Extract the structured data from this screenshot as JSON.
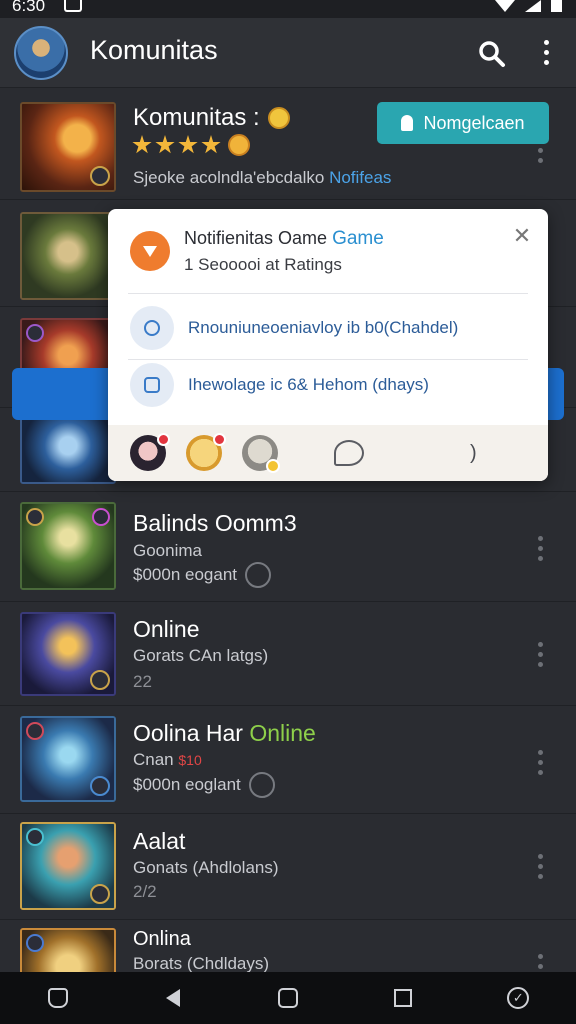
{
  "status_bar": {
    "time": "6:30"
  },
  "app_bar": {
    "title": "Komunitas"
  },
  "featured": {
    "title": "Komunitas :",
    "rating_stars": 4,
    "join_label": "Nomgelcaen",
    "description": "Sjeoke acolndla'ebcdalko",
    "description_link": "Nofifeas"
  },
  "popup": {
    "title_prefix": "Notifienitas Oame",
    "title_highlight": "Game",
    "subtitle": "1 Seooooi at Ratings",
    "items": [
      {
        "text": "Rnouniuneoeniavloy ib b0(Chahdel)"
      },
      {
        "text": "Ihewolage ic 6& Hehom (dhays)"
      }
    ],
    "footer_end": ")"
  },
  "rows": [
    {
      "title": "Balinds Oomm3",
      "sub": "Goonima",
      "meta": "$000n eogant",
      "has_ring": true
    },
    {
      "title": "Online",
      "sub": "Gorats CAn latgs)",
      "meta": "22",
      "has_ring": false
    },
    {
      "title": "Oolina Har",
      "title_accent": "Online",
      "sub": "Cnan",
      "sub_accent": "$10",
      "meta": "$000n eoglant",
      "has_ring": true
    },
    {
      "title": "Aalat",
      "sub": "Gonats (Ahdlolans)",
      "meta": "2/2",
      "has_ring": false
    },
    {
      "title": "Onlina",
      "sub": "Borats (Chdldays)",
      "meta": "",
      "has_ring": false
    }
  ],
  "colors": {
    "background": "#2a2c31",
    "join_button": "#2aa6b0",
    "link": "#4ba3e8",
    "online_green": "#8ed04a",
    "popup_icon_orange": "#ef7c2e"
  },
  "icons": {
    "appbar": [
      "search-icon",
      "more-vert-icon"
    ],
    "navbar": [
      "pentagon-icon",
      "back-icon",
      "home-icon",
      "recents-icon",
      "check-circle-icon"
    ]
  }
}
